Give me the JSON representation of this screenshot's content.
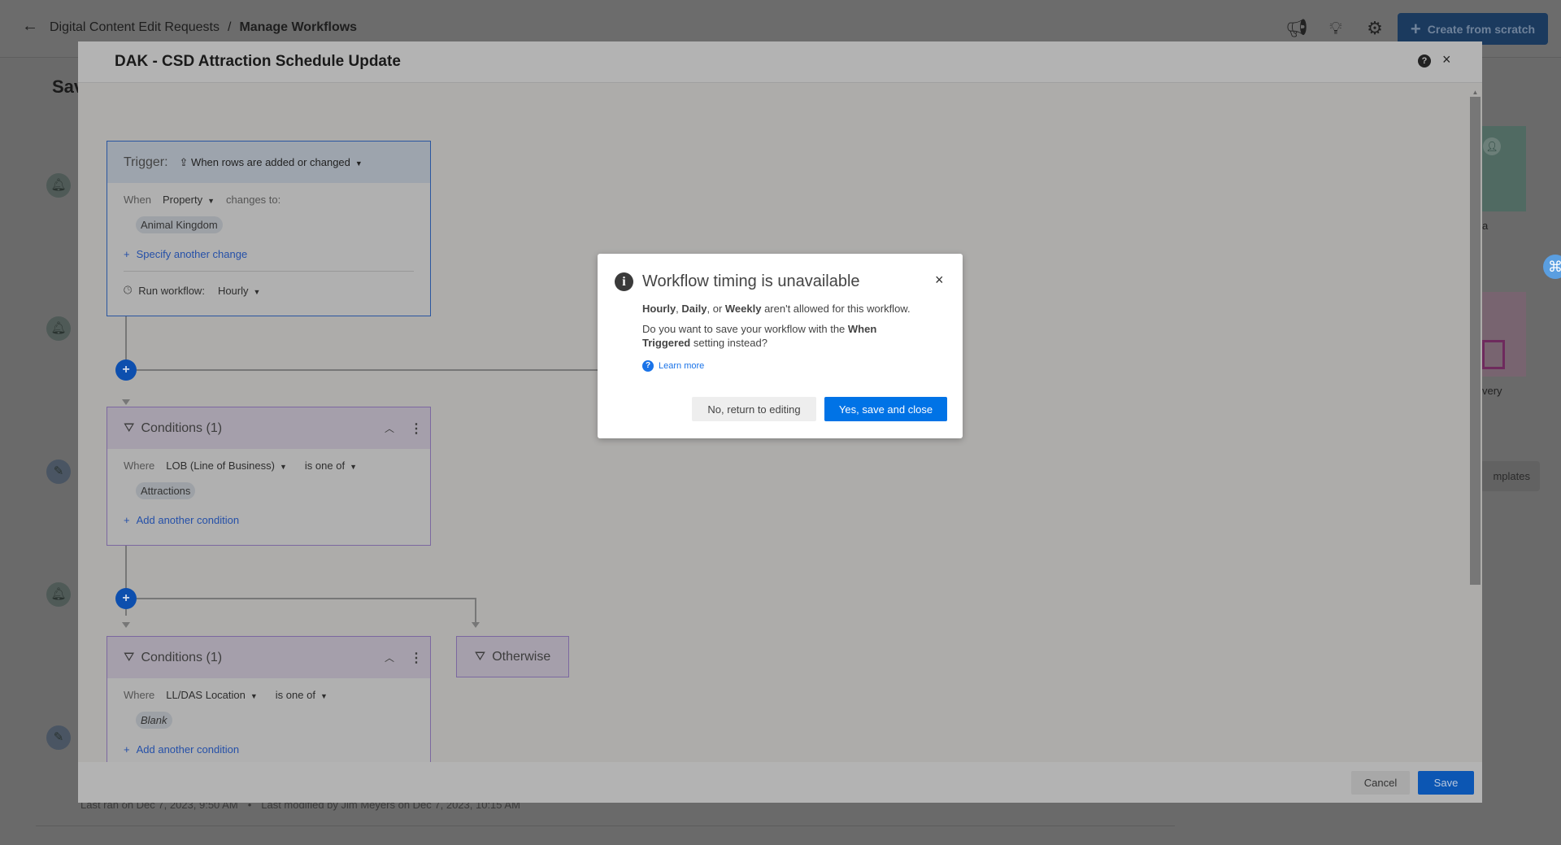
{
  "header": {
    "back_icon": "arrow-left-icon",
    "breadcrumb_parent": "Digital Content Edit Requests",
    "separator": "/",
    "breadcrumb_current": "Manage Workflows",
    "icons": [
      "megaphone-icon",
      "lightbulb-icon",
      "gear-icon"
    ],
    "create_label": "Create from scratch"
  },
  "background": {
    "page_title_partial": "Sav",
    "card1_partial": "a",
    "card2_partial": "very",
    "templates_partial": "mplates",
    "last_ran": "Last ran on Dec 7, 2023, 9:50 AM",
    "bullet": "•",
    "last_modified": "Last modified by Jim Meyers on Dec 7, 2023, 10:15 AM"
  },
  "modal": {
    "title": "DAK - CSD Attraction Schedule Update",
    "cancel_label": "Cancel",
    "save_label": "Save",
    "trigger": {
      "label": "Trigger:",
      "type": "When rows are added or changed",
      "when": "When",
      "field": "Property",
      "changes_to": "changes to:",
      "value": "Animal Kingdom",
      "add_change": "Specify another change",
      "run_label": "Run workflow:",
      "run_value": "Hourly"
    },
    "conditions": [
      {
        "title": "Conditions (1)",
        "where": "Where",
        "field": "LOB (Line of Business)",
        "operator": "is one of",
        "value": "Attractions",
        "add": "Add another condition"
      },
      {
        "title": "Conditions (1)",
        "where": "Where",
        "field": "LL/DAS Location",
        "operator": "is one of",
        "value": "Blank",
        "add": "Add another condition"
      }
    ],
    "otherwise": "Otherwise"
  },
  "dialog": {
    "title": "Workflow timing is unavailable",
    "b1": "Hourly",
    "s1": ", ",
    "b2": "Daily",
    "s2": ", or ",
    "b3": "Weekly",
    "s3": " aren't allowed for this workflow.",
    "q1": "Do you want to save your workflow with the ",
    "qb": "When Triggered",
    "q2": " setting instead?",
    "learn_more": "Learn more",
    "no_label": "No, return to editing",
    "yes_label": "Yes, save and close"
  },
  "colors": {
    "primary": "#0073e6",
    "dialog_bg": "#ffffff"
  }
}
